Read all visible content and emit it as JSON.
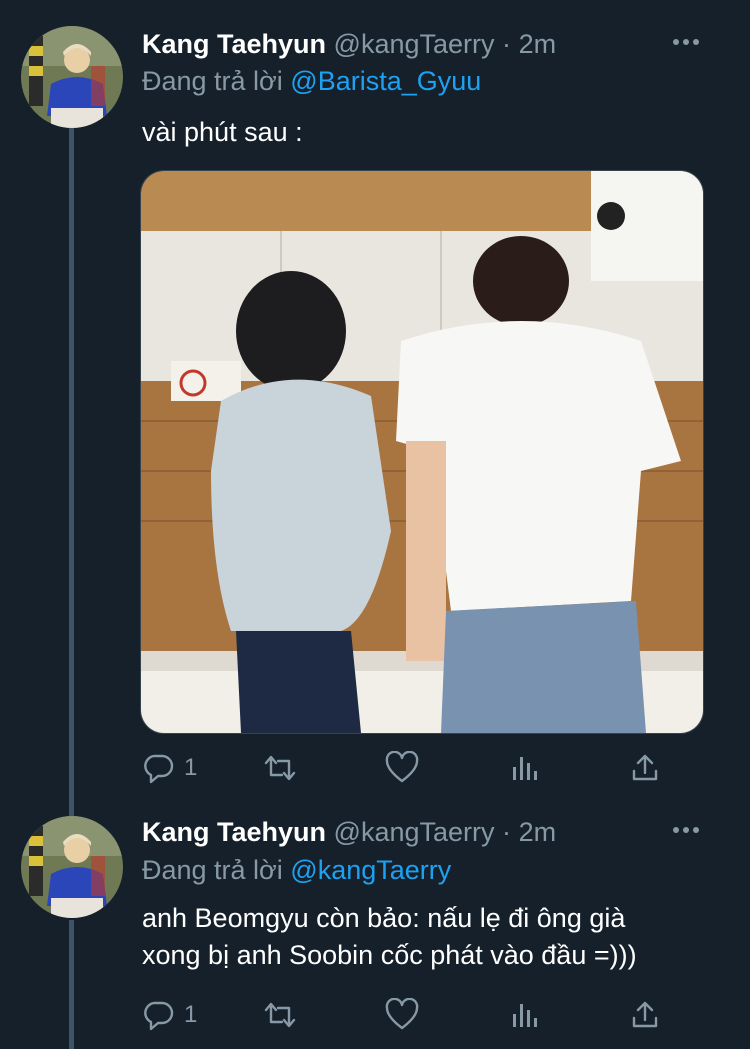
{
  "tweets": [
    {
      "name": "Kang Taehyun",
      "handle": "@kangTaerry",
      "separator": "·",
      "time": "2m",
      "reply_prefix": "Đang trả lời",
      "reply_to": "@Barista_Gyuu",
      "text": "vài phút sau :",
      "has_media": true,
      "actions": {
        "reply_count": "1",
        "retweet_count": "",
        "like_count": ""
      },
      "avatar_icon": "profile-photo",
      "media_icon": "kitchen-photo"
    },
    {
      "name": "Kang Taehyun",
      "handle": "@kangTaerry",
      "separator": "·",
      "time": "2m",
      "reply_prefix": "Đang trả lời",
      "reply_to": "@kangTaerry",
      "text_lines": [
        "anh Beomgyu còn bảo: nấu lẹ đi ông già",
        "xong bị anh Soobin cốc phát vào đầu =)))"
      ],
      "actions": {
        "reply_count": "1",
        "retweet_count": "",
        "like_count": ""
      },
      "avatar_icon": "profile-photo"
    }
  ],
  "icons": {
    "more": "more-dots-icon",
    "reply": "reply-bubble-icon",
    "retweet": "retweet-icon",
    "like": "heart-icon",
    "stats": "analytics-icon",
    "share": "share-icon"
  },
  "colors": {
    "background": "#15202b",
    "text_primary": "#ffffff",
    "text_secondary": "#8899a6",
    "link": "#1da1f2",
    "thread_line": "#3d5466"
  }
}
